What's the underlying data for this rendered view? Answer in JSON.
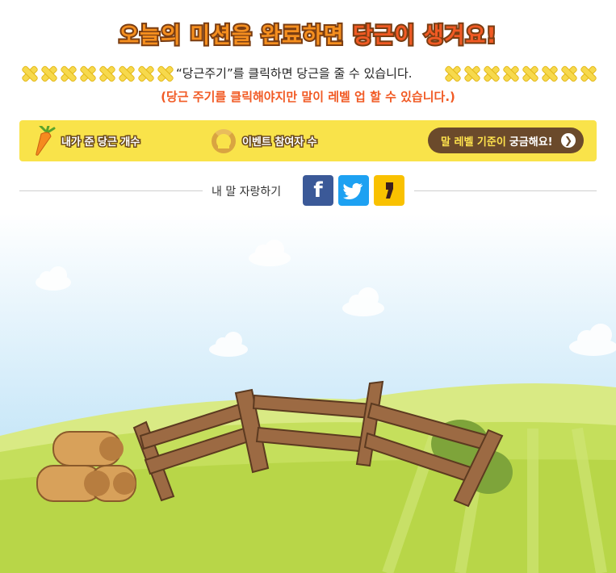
{
  "header": {
    "title_part1": "오늘의 미션을 완료하면",
    "title_part2": "당근이 생겨요!"
  },
  "instructions": {
    "text": "“당근주기”를 클릭하면 당근을 줄 수 있습니다.",
    "note": "(당근 주기를 클릭해야지만 말이 레벨 업 할 수 있습니다.)"
  },
  "stats": {
    "carrot_label": "내가 준 당근 개수",
    "participants_label": "이벤트 참여자 수",
    "level_button_highlight": "말 레벨 기준이",
    "level_button_rest": "궁금해요!",
    "icons": {
      "carrot": "carrot-icon",
      "horseshoe": "horseshoe-icon",
      "arrow": "chevron-right-icon"
    }
  },
  "share": {
    "label": "내 말 자랑하기",
    "buttons": [
      {
        "name": "facebook",
        "glyph": "f"
      },
      {
        "name": "twitter",
        "glyph": ""
      },
      {
        "name": "kakaostory",
        "glyph": ""
      }
    ]
  },
  "colors": {
    "accent_orange": "#f15a24",
    "stats_bg": "#f9e34a",
    "button_brown": "#6b4a2b",
    "sky": "#bfe3f7",
    "grass": "#b8d648"
  }
}
